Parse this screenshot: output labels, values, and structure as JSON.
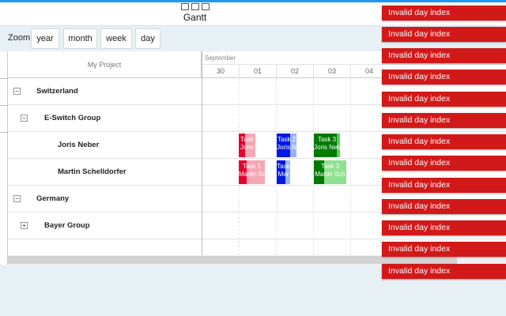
{
  "window": {
    "title": "Gantt"
  },
  "toolbar": {
    "zoom_label": "Zoom:",
    "buttons": [
      "year",
      "month",
      "week",
      "day"
    ]
  },
  "gantt": {
    "project_header": "My Project",
    "month": "September",
    "days": [
      "30",
      "01",
      "02",
      "03",
      "04"
    ],
    "rows": [
      {
        "label": "Switzerland",
        "toggle": "−"
      },
      {
        "label": "E-Switch Group",
        "toggle": "−"
      },
      {
        "label": "Joris Neber"
      },
      {
        "label": "Martin Schelldorfer"
      },
      {
        "label": "Germany",
        "toggle": "−"
      },
      {
        "label": "Bayer Group",
        "toggle": "+"
      }
    ],
    "tasks": [
      {
        "line1": "Task",
        "line2": "Joris",
        "color": "#f4a7b5",
        "progress_color": "#e8002c"
      },
      {
        "line1": "Task 2",
        "line2": "Joris N",
        "color": "#9bb4ff",
        "progress_color": "#0018e8"
      },
      {
        "line1": "Task 3",
        "line2": "Joris Neb",
        "color": "#5dcc5d",
        "progress_color": "#007a00"
      },
      {
        "line1": "Task 1",
        "line2": "Martin Sch",
        "color": "#f4a7b5",
        "progress_color": "#e8002c"
      },
      {
        "line1": "Task",
        "line2": "Mar",
        "color": "#9bb4ff",
        "progress_color": "#0018e8"
      },
      {
        "line1": "Task 3",
        "line2": "Martin Sch",
        "color": "#8fe08f",
        "progress_color": "#007a00"
      }
    ]
  },
  "notifications": [
    "Invalid day index",
    "Invalid day index",
    "Invalid day index",
    "Invalid day index",
    "Invalid day index",
    "Invalid day index",
    "Invalid day index",
    "Invalid day index",
    "Invalid day index",
    "Invalid day index",
    "Invalid day index",
    "Invalid day index",
    "Invalid day index"
  ]
}
